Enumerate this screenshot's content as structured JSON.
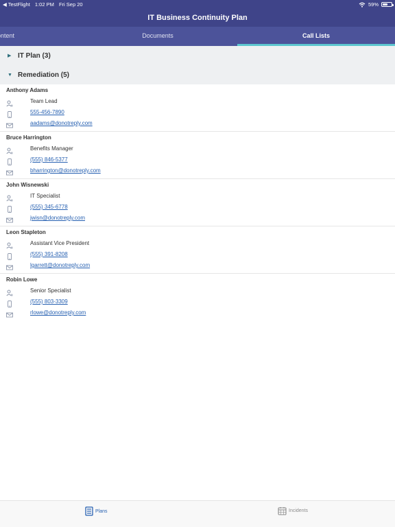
{
  "status_bar": {
    "back_label": "◀ TestFlight",
    "time": "1:02 PM",
    "date": "Fri Sep 20",
    "battery": "59%",
    "battery_level": 0.59
  },
  "header": {
    "title": "IT Business Continuity Plan"
  },
  "tabs": [
    {
      "label": "ontent"
    },
    {
      "label": "Documents"
    },
    {
      "label": "Call Lists",
      "active": true
    }
  ],
  "sections": [
    {
      "title": "IT Plan (3)",
      "expanded": false
    },
    {
      "title": "Remediation (5)",
      "expanded": true
    }
  ],
  "contacts": [
    {
      "name": "Anthony Adams",
      "role": "Team Lead",
      "phone": "555-456-7890",
      "email": "aadams@donotreply.com"
    },
    {
      "name": "Bruce Harrington",
      "role": "Benefits Manager",
      "phone": "(555) 846-5377",
      "email": "bharrington@donotreply.com"
    },
    {
      "name": "John Wisnewski",
      "role": "IT Specialist",
      "phone": "(555) 345-6778",
      "email": "jwisn@donotreply.com"
    },
    {
      "name": "Leon Stapleton",
      "role": "Assistant Vice President",
      "phone": "(555) 391-8208",
      "email": "lgarrett@donotreply.com"
    },
    {
      "name": "Robin Lowe",
      "role": "Senior Specialist",
      "phone": "(555) 803-3309",
      "email": "rlowe@donotreply.com"
    }
  ],
  "bottom_nav": [
    {
      "label": "Plans",
      "icon": "plans-icon",
      "active": true
    },
    {
      "label": "Incidents",
      "icon": "calendar-icon",
      "active": false
    }
  ],
  "colors": {
    "header": "#3f4489",
    "tabs": "#4c539a",
    "tab_indicator": "#5cc6cf",
    "link": "#2660b1"
  }
}
